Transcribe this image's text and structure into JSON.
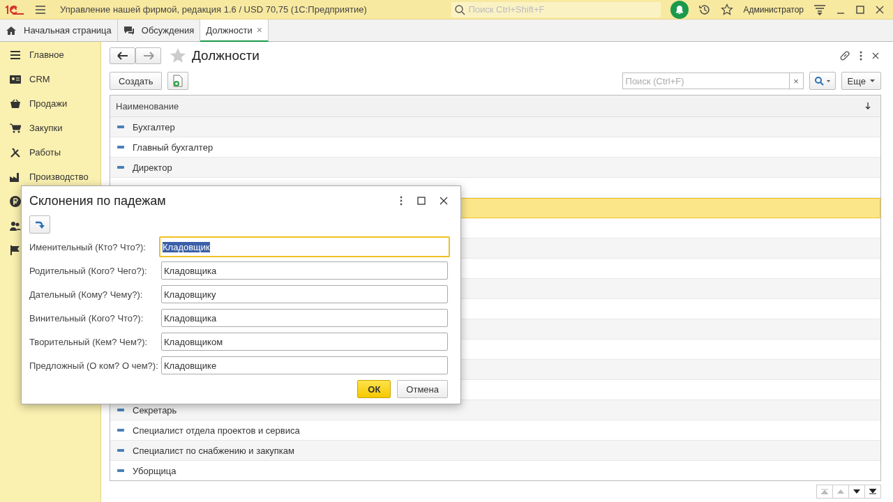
{
  "title_bar": {
    "title": "Управление нашей фирмой, редакция 1.6 / USD 70,75  (1С:Предприятие)",
    "search": {
      "placeholder": "Поиск Ctrl+Shift+F"
    },
    "user": "Администратор"
  },
  "tabs": [
    {
      "label": "Начальная страница",
      "kind": "home",
      "selected": false,
      "closable": false
    },
    {
      "label": "Обсуждения",
      "kind": "chat",
      "selected": false,
      "closable": false
    },
    {
      "label": "Должности",
      "kind": "plain",
      "selected": true,
      "closable": true
    }
  ],
  "tab_close": "×",
  "sidebar": {
    "items": [
      {
        "label": "Главное",
        "kind": "menu"
      },
      {
        "label": "CRM",
        "kind": "card"
      },
      {
        "label": "Продажи",
        "kind": "basket"
      },
      {
        "label": "Закупки",
        "kind": "cart"
      },
      {
        "label": "Работы",
        "kind": "tools"
      },
      {
        "label": "Производство",
        "kind": "factory"
      },
      {
        "kind": "ruble"
      },
      {
        "kind": "people"
      },
      {
        "kind": "flag"
      }
    ]
  },
  "form": {
    "title": "Должности",
    "create_button": "Создать",
    "search": {
      "placeholder": "Поиск (Ctrl+F)"
    },
    "clear": "×",
    "more_button": "Еще",
    "table": {
      "columns": [
        "Наименование"
      ],
      "rows": [
        {
          "name": "Бухгалтер",
          "selected": false
        },
        {
          "name": "Главный бухгалтер",
          "selected": false
        },
        {
          "name": "Директор",
          "selected": false
        },
        {
          "selected": false
        },
        {
          "selected": true
        },
        {
          "selected": false
        },
        {
          "selected": false
        },
        {
          "selected": false
        },
        {
          "selected": false
        },
        {
          "selected": false
        },
        {
          "selected": false
        },
        {
          "selected": false
        },
        {
          "selected": false
        },
        {
          "selected": false
        },
        {
          "name": "Секретарь",
          "selected": false
        },
        {
          "name": "Специалист отдела проектов и сервиса",
          "selected": false
        },
        {
          "name": "Специалист по снабжению и закупкам",
          "selected": false
        },
        {
          "name": "Уборщица",
          "selected": false
        }
      ]
    }
  },
  "dialog": {
    "title": "Склонения по падежам",
    "fields": [
      {
        "label": "Именительный (Кто? Что?):",
        "value": "Кладовщик",
        "focused": true
      },
      {
        "label": "Родительный (Кого? Чего?):",
        "value": "Кладовщика",
        "focused": false
      },
      {
        "label": "Дательный (Кому? Чему?):",
        "value": "Кладовщику",
        "focused": false
      },
      {
        "label": "Винительный (Кого? Что?):",
        "value": "Кладовщика",
        "focused": false
      },
      {
        "label": "Творительный (Кем? Чем?):",
        "value": "Кладовщиком",
        "focused": false
      },
      {
        "label": "Предложный (О ком? О чем?):",
        "value": "Кладовщике",
        "focused": false
      }
    ],
    "ok_button": "ОК",
    "cancel_button": "Отмена"
  }
}
